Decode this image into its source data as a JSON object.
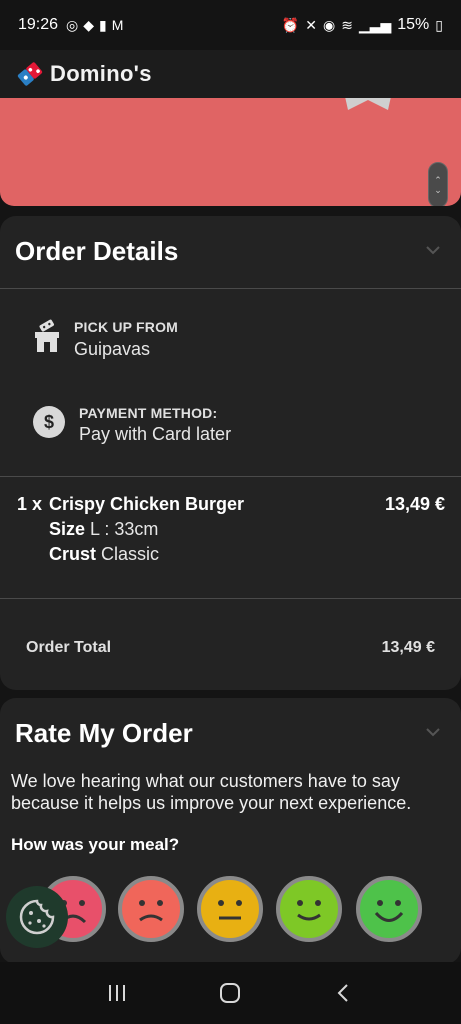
{
  "status_bar": {
    "time": "19:26",
    "battery": "15%"
  },
  "header": {
    "brand": "Domino's"
  },
  "order_details": {
    "title": "Order Details",
    "pickup_label": "PICK UP FROM",
    "pickup_value": "Guipavas",
    "payment_label": "PAYMENT METHOD:",
    "payment_value": "Pay with Card later",
    "item": {
      "quantity": "1 x",
      "name": "Crispy Chicken Burger",
      "price": "13,49 €",
      "size_label": "Size",
      "size_value": "L : 33cm",
      "crust_label": "Crust",
      "crust_value": "Classic"
    },
    "total_label": "Order Total",
    "total_value": "13,49 €"
  },
  "rate": {
    "title": "Rate My Order",
    "intro": "We love hearing what our customers have to say because it helps us improve your next experience.",
    "question": "How was your meal?",
    "faces": [
      {
        "name": "very-bad",
        "color": "#e8506a"
      },
      {
        "name": "bad",
        "color": "#f0665a"
      },
      {
        "name": "neutral",
        "color": "#e8b012"
      },
      {
        "name": "good",
        "color": "#7ec826"
      },
      {
        "name": "very-good",
        "color": "#4ec24a"
      }
    ]
  },
  "colors": {
    "promo": "#e06464",
    "card": "#232323",
    "background": "#141414",
    "brand_blue": "#2a7fc4",
    "brand_red": "#e31837"
  }
}
